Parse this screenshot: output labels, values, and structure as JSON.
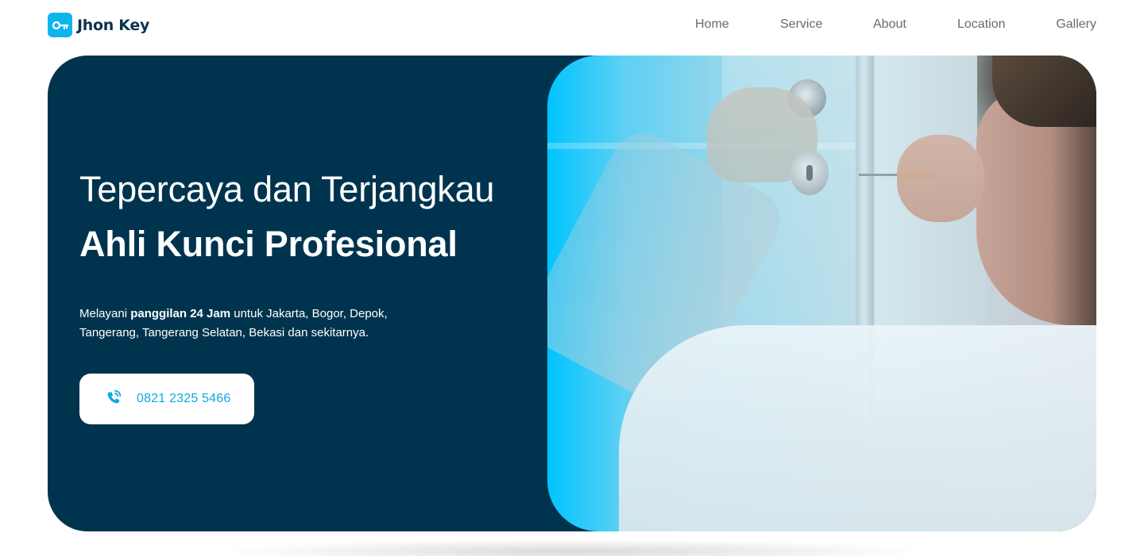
{
  "brand": {
    "name": "Jhon Key",
    "icon": "key-icon"
  },
  "nav": {
    "items": [
      {
        "label": "Home"
      },
      {
        "label": "Service"
      },
      {
        "label": "About"
      },
      {
        "label": "Location"
      },
      {
        "label": "Gallery"
      }
    ]
  },
  "hero": {
    "title": "Tepercaya dan Terjangkau",
    "subtitle": "Ahli Kunci Profesional",
    "desc_prefix": "Melayani ",
    "desc_bold": "panggilan 24 Jam",
    "desc_suffix": " untuk Jakarta, Bogor, Depok, Tangerang, Tangerang Selatan, Bekasi dan sekitarnya.",
    "phone": "0821 2325 5466",
    "phone_icon": "phone-call-icon",
    "photo_subject": "locksmith-photo"
  },
  "colors": {
    "brand": "#0fb4ec",
    "hero_bg": "#00344e",
    "accent": "#0fa8e3",
    "nav_text": "#666a70"
  }
}
